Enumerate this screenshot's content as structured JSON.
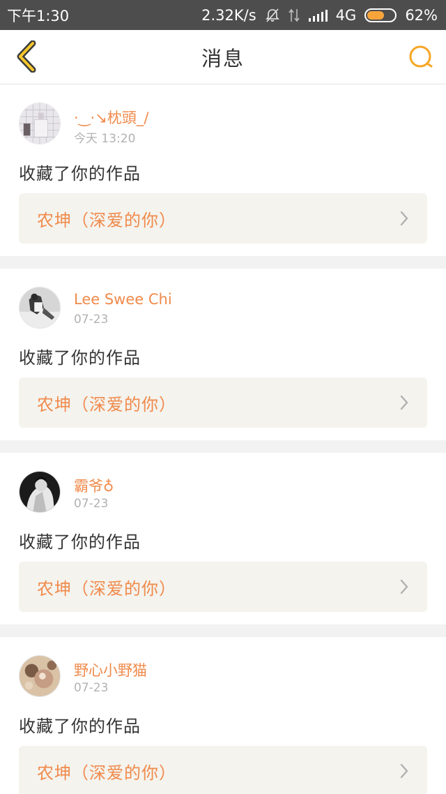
{
  "status_bar": {
    "time": "下午1:30",
    "network_speed": "2.32K/s",
    "network_type": "4G",
    "battery_percent": "62%",
    "battery_level": 0.62,
    "icons": [
      "silent-bell-icon",
      "data-arrows-icon",
      "signal-icon",
      "battery-icon"
    ]
  },
  "header": {
    "title": "消息",
    "back_icon": "chevron-left-icon",
    "search_icon": "search-icon",
    "accent_color": "#f6a623"
  },
  "notifications": [
    {
      "user": "·‿·↘枕頭_/",
      "time": "今天 13:20",
      "action": "收藏了你的作品",
      "work": "农坤（深爱的你）"
    },
    {
      "user": "Lee Swee Chi",
      "time": "07-23",
      "action": "收藏了你的作品",
      "work": "农坤（深爱的你）"
    },
    {
      "user": "霸爷♁",
      "time": "07-23",
      "action": "收藏了你的作品",
      "work": "农坤（深爱的你）"
    },
    {
      "user": "野心小野猫",
      "time": "07-23",
      "action": "收藏了你的作品",
      "work": "农坤（深爱的你）"
    }
  ],
  "colors": {
    "username": "#f08a4b",
    "work_title": "#f08a4b",
    "work_link_bg": "#f4f3ee",
    "status_bar_bg": "#4d4d4d"
  }
}
